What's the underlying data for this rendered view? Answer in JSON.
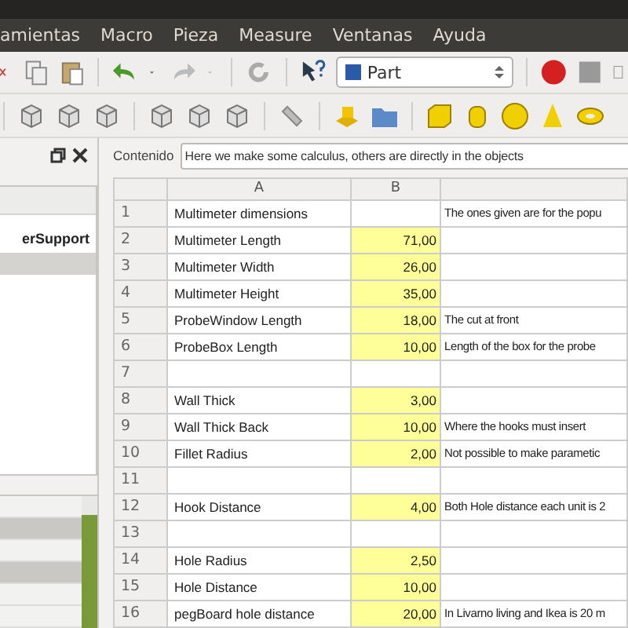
{
  "menubar": [
    "amientas",
    "Macro",
    "Pieza",
    "Measure",
    "Ventanas",
    "Ayuda"
  ],
  "workbench": "Part",
  "tree": {
    "items": [
      {
        "label": "erSupport",
        "selected": false
      },
      {
        "selected": true
      }
    ]
  },
  "content": {
    "label": "Contenido",
    "value": "Here we make some calculus, others are directly in the objects"
  },
  "table": {
    "columns": [
      "A",
      "B"
    ],
    "rows": [
      {
        "n": "1",
        "a": "Multimeter dimensions",
        "b": "",
        "c": "The ones given are for the popu",
        "highlighted": false
      },
      {
        "n": "2",
        "a": "Multimeter Length",
        "b": "71,00",
        "c": "",
        "highlighted": true
      },
      {
        "n": "3",
        "a": "Multimeter Width",
        "b": "26,00",
        "c": "",
        "highlighted": true
      },
      {
        "n": "4",
        "a": "Multimeter Height",
        "b": "35,00",
        "c": "",
        "highlighted": true
      },
      {
        "n": "5",
        "a": "ProbeWindow Length",
        "b": "18,00",
        "c": "The cut at front",
        "highlighted": true
      },
      {
        "n": "6",
        "a": "ProbeBox Length",
        "b": "10,00",
        "c": "Length of the box for the probe",
        "highlighted": true
      },
      {
        "n": "7",
        "a": "",
        "b": "",
        "c": "",
        "highlighted": false
      },
      {
        "n": "8",
        "a": "Wall Thick",
        "b": "3,00",
        "c": "",
        "highlighted": true
      },
      {
        "n": "9",
        "a": "Wall Thick Back",
        "b": "10,00",
        "c": "Where the hooks must insert",
        "highlighted": true
      },
      {
        "n": "10",
        "a": "Fillet Radius",
        "b": "2,00",
        "c": "Not possible to make parametic",
        "highlighted": true
      },
      {
        "n": "11",
        "a": "",
        "b": "",
        "c": "",
        "highlighted": false
      },
      {
        "n": "12",
        "a": "Hook Distance",
        "b": "4,00",
        "c": "Both Hole distance each unit is 2",
        "highlighted": true
      },
      {
        "n": "13",
        "a": "",
        "b": "",
        "c": "",
        "highlighted": false
      },
      {
        "n": "14",
        "a": "Hole Radius",
        "b": "2,50",
        "c": "",
        "highlighted": true
      },
      {
        "n": "15",
        "a": "Hole Distance",
        "b": "10,00",
        "c": "",
        "highlighted": true
      },
      {
        "n": "16",
        "a": "pegBoard hole distance",
        "b": "20,00",
        "c": "In Livarno living and Ikea is 20 m",
        "highlighted": true
      }
    ]
  }
}
